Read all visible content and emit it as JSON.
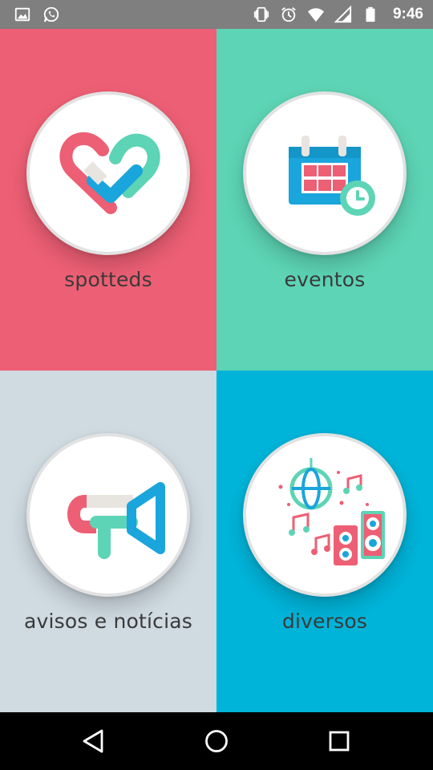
{
  "status_bar": {
    "time": "9:46",
    "left_icons": [
      "gallery-icon",
      "whatsapp-icon"
    ],
    "right_icons": [
      "vibrate-icon",
      "alarm-icon",
      "wifi-icon",
      "signal-icon",
      "battery-icon"
    ]
  },
  "tiles": [
    {
      "label": "spotteds",
      "icon": "heart-check-icon",
      "bg": "#ed5f74"
    },
    {
      "label": "eventos",
      "icon": "calendar-clock-icon",
      "bg": "#5dd4b5"
    },
    {
      "label": "avisos e notícias",
      "icon": "megaphone-icon",
      "bg": "#cfdae1"
    },
    {
      "label": "diversos",
      "icon": "party-music-icon",
      "bg": "#00b4d9"
    }
  ],
  "nav_bar": {
    "buttons": [
      "back-icon",
      "home-icon",
      "recents-icon"
    ]
  },
  "colors": {
    "red": "#ed5f74",
    "teal": "#5dd4b5",
    "blue": "#1aa5dc",
    "light": "#e8e4df"
  }
}
